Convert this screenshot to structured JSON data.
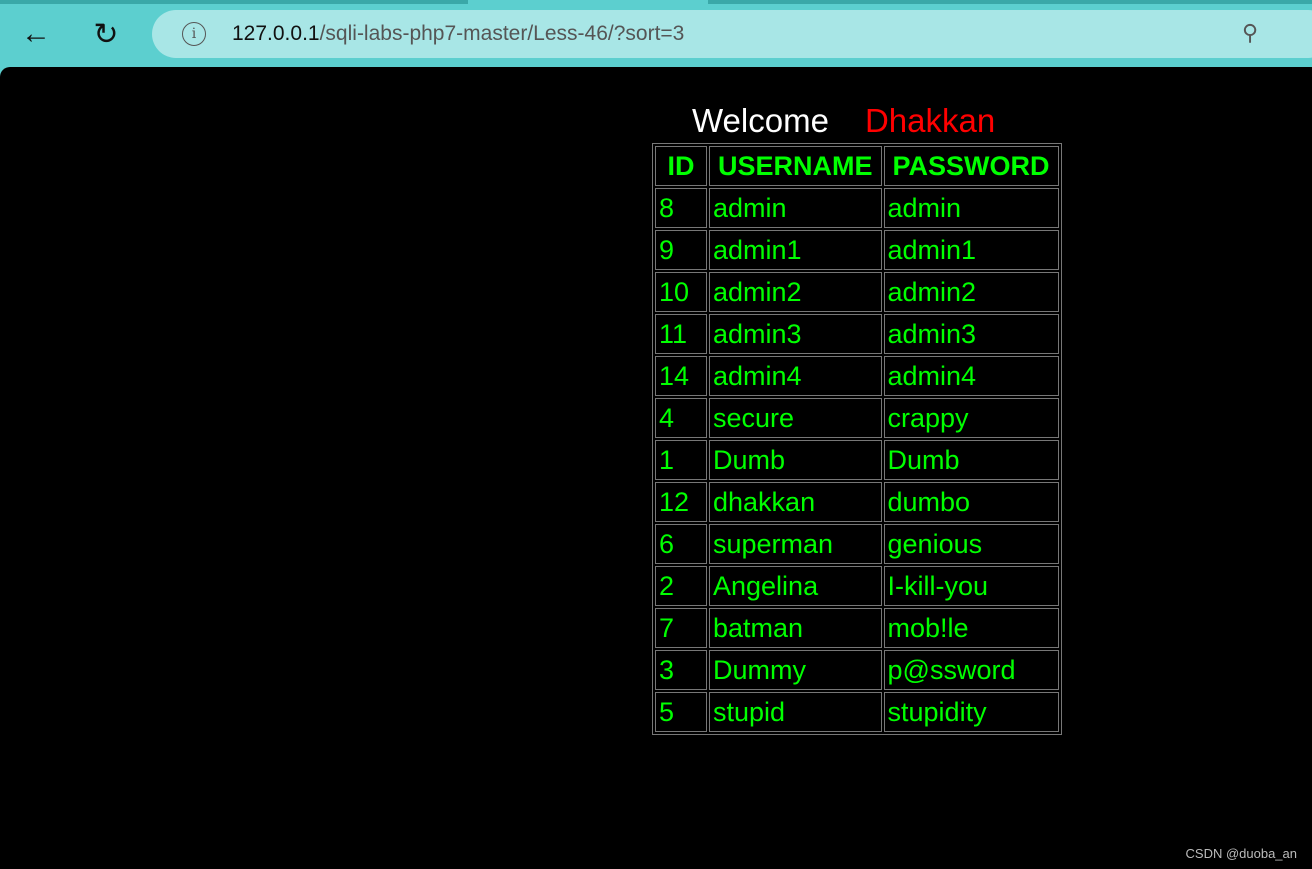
{
  "browser": {
    "url_host": "127.0.0.1",
    "url_path": "/sqli-labs-php7-master/Less-46/?sort=3",
    "icons": [
      "back-arrow-icon",
      "reload-icon",
      "info-icon",
      "zoom-icon"
    ]
  },
  "page": {
    "welcome": "Welcome",
    "name": "Dhakkan",
    "headers": [
      "ID",
      "USERNAME",
      "PASSWORD"
    ],
    "rows": [
      [
        "8",
        "admin",
        "admin"
      ],
      [
        "9",
        "admin1",
        "admin1"
      ],
      [
        "10",
        "admin2",
        "admin2"
      ],
      [
        "11",
        "admin3",
        "admin3"
      ],
      [
        "14",
        "admin4",
        "admin4"
      ],
      [
        "4",
        "secure",
        "crappy"
      ],
      [
        "1",
        "Dumb",
        "Dumb"
      ],
      [
        "12",
        "dhakkan",
        "dumbo"
      ],
      [
        "6",
        "superman",
        "genious"
      ],
      [
        "2",
        "Angelina",
        "I-kill-you"
      ],
      [
        "7",
        "batman",
        "mob!le"
      ],
      [
        "3",
        "Dummy",
        "p@ssword"
      ],
      [
        "5",
        "stupid",
        "stupidity"
      ]
    ]
  },
  "watermark": "CSDN @duoba_an",
  "colors": {
    "text": "#00ff00",
    "name": "#ff0000",
    "background": "#000000",
    "chrome": "#5ccfcf"
  }
}
